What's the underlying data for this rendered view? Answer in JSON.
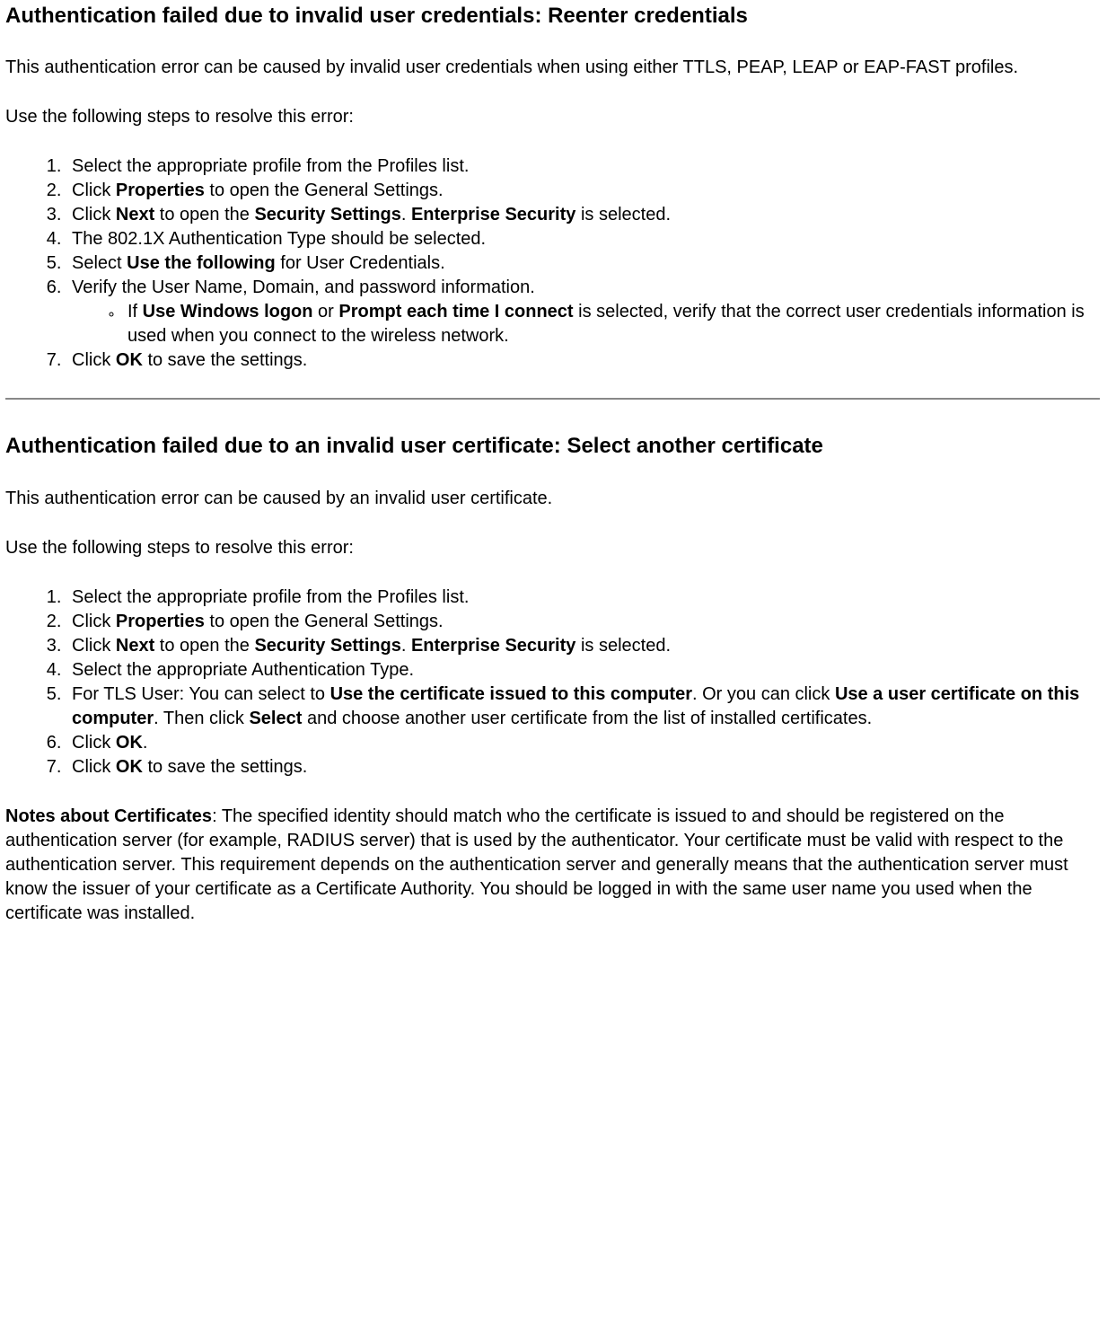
{
  "section1": {
    "heading": "Authentication failed due to invalid user credentials: Reenter credentials",
    "intro": "This authentication error can be caused by invalid user credentials when using either TTLS, PEAP, LEAP or EAP-FAST profiles.",
    "stepsLead": "Use the following steps to resolve this error:",
    "step1": "Select the appropriate profile from the Profiles list.",
    "step2_pre": "Click ",
    "step2_b1": "Properties",
    "step2_post": " to open the General Settings.",
    "step3_pre": "Click ",
    "step3_b1": "Next",
    "step3_mid1": " to open the ",
    "step3_b2": "Security Settings",
    "step3_mid2": ". ",
    "step3_b3": "Enterprise Security",
    "step3_post": " is selected.",
    "step4": "The 802.1X Authentication Type should be selected.",
    "step5_pre": "Select ",
    "step5_b1": "Use the following",
    "step5_post": " for User Credentials.",
    "step6": "Verify the User Name, Domain, and password information.",
    "step6_sub_pre": "If ",
    "step6_sub_b1": "Use Windows logon",
    "step6_sub_mid": " or ",
    "step6_sub_b2": "Prompt each time I connect",
    "step6_sub_post": " is selected, verify that the correct user credentials information is used when you connect to the wireless network.",
    "step7_pre": "Click ",
    "step7_b1": "OK",
    "step7_post": " to save the settings."
  },
  "section2": {
    "heading": "Authentication failed due to an invalid user certificate: Select another certificate",
    "intro": "This authentication error can be caused by an invalid user certificate.",
    "stepsLead": "Use the following steps to resolve this error:",
    "step1": "Select the appropriate profile from the Profiles list.",
    "step2_pre": "Click ",
    "step2_b1": "Properties",
    "step2_post": " to open the General Settings.",
    "step3_pre": "Click ",
    "step3_b1": "Next",
    "step3_mid1": " to open the ",
    "step3_b2": "Security Settings",
    "step3_mid2": ". ",
    "step3_b3": "Enterprise Security",
    "step3_post": " is selected.",
    "step4": "Select the appropriate Authentication Type.",
    "step5_pre": "For TLS User: You can select to ",
    "step5_b1": "Use the certificate issued to this computer",
    "step5_mid1": ". Or you can click ",
    "step5_b2": "Use a user certificate on this computer",
    "step5_mid2": ". Then click ",
    "step5_b3": "Select",
    "step5_post": " and choose another user certificate from the list of installed certificates.",
    "step6_pre": "Click ",
    "step6_b1": "OK",
    "step6_post": ".",
    "step7_pre": "Click ",
    "step7_b1": "OK",
    "step7_post": " to save the settings.",
    "notes_label": "Notes about Certificates",
    "notes_body": ": The specified identity should match who the certificate is issued to and should be registered on the authentication server (for example, RADIUS server) that is used by the authenticator. Your certificate must be valid with respect to the authentication server. This requirement depends on the authentication server and generally means that the authentication server must know the issuer of your certificate as a Certificate Authority. You should be logged in with the same user name you used when the certificate was installed."
  }
}
